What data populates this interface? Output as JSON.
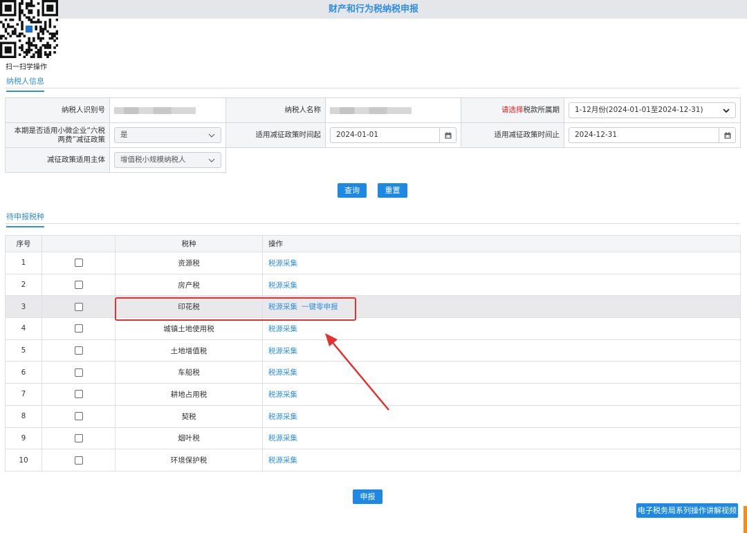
{
  "page": {
    "title": "财产和行为税纳税申报"
  },
  "qr": {
    "caption": "扫一扫学操作"
  },
  "taxpayer_section": {
    "tab_label": "纳税人信息"
  },
  "form": {
    "taxpayer_id_label": "纳税人识别号",
    "taxpayer_name_label": "纳税人名称",
    "period_label_red": "请选择",
    "period_label": "税款所属期",
    "period_value": "1-12月份(2024-01-01至2024-12-31)",
    "small_micro_label": "本期是否适用小微企业“六税两费”减征政策",
    "small_micro_value": "是",
    "policy_start_label": "适用减征政策时间起",
    "policy_start_value": "2024-01-01",
    "policy_end_label": "适用减征政策时间止",
    "policy_end_value": "2024-12-31",
    "subject_label": "减征政策适用主体",
    "subject_value": "增值税小规模纳税人"
  },
  "buttons": {
    "query": "查询",
    "reset": "重置",
    "declare": "申报",
    "video": "电子税务局系列操作讲解视频"
  },
  "pending_section": {
    "tab_label": "待申报税种"
  },
  "tax_table": {
    "headers": {
      "seq": "序号",
      "check": "",
      "tax": "税种",
      "ops": "操作"
    },
    "rows": [
      {
        "seq": "1",
        "tax": "资源税",
        "ops": [
          "税源采集"
        ]
      },
      {
        "seq": "2",
        "tax": "房产税",
        "ops": [
          "税源采集"
        ]
      },
      {
        "seq": "3",
        "tax": "印花税",
        "ops": [
          "税源采集",
          "一键零申报"
        ]
      },
      {
        "seq": "4",
        "tax": "城镇土地使用税",
        "ops": [
          "税源采集"
        ]
      },
      {
        "seq": "5",
        "tax": "土地增值税",
        "ops": [
          "税源采集"
        ]
      },
      {
        "seq": "6",
        "tax": "车船税",
        "ops": [
          "税源采集"
        ]
      },
      {
        "seq": "7",
        "tax": "耕地占用税",
        "ops": [
          "税源采集"
        ]
      },
      {
        "seq": "8",
        "tax": "契税",
        "ops": [
          "税源采集"
        ]
      },
      {
        "seq": "9",
        "tax": "烟叶税",
        "ops": [
          "税源采集"
        ]
      },
      {
        "seq": "10",
        "tax": "环境保护税",
        "ops": [
          "税源采集"
        ]
      }
    ]
  },
  "icons": {
    "calendar": "calendar-icon",
    "chevron": "chevron-down-icon",
    "qr": "qr-code-icon",
    "arrow": "annotation-arrow"
  },
  "colors": {
    "accent": "#1e88e5",
    "link": "#2f8fe0",
    "annotation": "#e53030",
    "required": "#e02020"
  }
}
